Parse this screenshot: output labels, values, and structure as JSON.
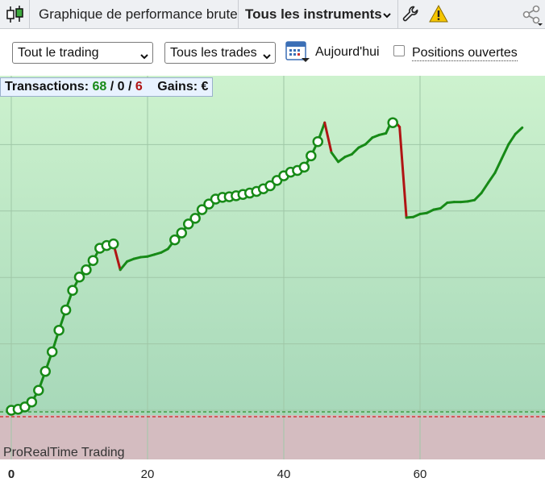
{
  "toolbar": {
    "candles_icon": "candlestick-chart-icon",
    "title": "Graphique de performance brute",
    "instruments": "Tous les instruments",
    "wrench_icon": "wrench-icon",
    "warning_icon": "warning-icon",
    "share_icon": "share-icon"
  },
  "filters": {
    "trading_select": "Tout le trading",
    "trades_select": "Tous les trades",
    "calendar_icon": "calendar-icon",
    "date_label": "Aujourd'hui",
    "open_positions_label": "Positions ouvertes",
    "open_positions_checked": false
  },
  "summary": {
    "transactions_label": "Transactions:",
    "wins": "68",
    "sep1": "/",
    "neutral": "0",
    "sep2": "/",
    "losses": "6",
    "gains_label": "Gains: €"
  },
  "watermark": "ProRealTime Trading",
  "colors": {
    "win": "#178a17",
    "loss": "#b01414",
    "profit_zone_top": "#c8f0c8",
    "profit_zone_bottom": "#a8d8b8",
    "loss_zone": "#d4bcc0"
  },
  "chart_data": {
    "type": "line",
    "title": "",
    "xlabel": "",
    "ylabel": "",
    "x_ticks": [
      "0",
      "20",
      "40",
      "60"
    ],
    "xlim": [
      0,
      78
    ],
    "ylim": [
      -5.6,
      100
    ],
    "y_gridlines": [
      0,
      20,
      40,
      60,
      80
    ],
    "trade_markers": {
      "x": [
        0,
        1,
        2,
        3,
        4,
        5,
        6,
        7,
        8,
        9,
        10,
        11,
        12,
        13,
        14,
        15,
        24,
        25,
        26,
        27,
        28,
        29,
        30,
        31,
        32,
        33,
        34,
        35,
        36,
        37,
        38,
        39,
        40,
        41,
        42,
        43,
        44,
        45,
        56
      ],
      "y": [
        0,
        0.3,
        1,
        2.5,
        6,
        11.7,
        17.6,
        24.1,
        30.2,
        36.1,
        40.1,
        42.3,
        45.1,
        48.8,
        49.6,
        50.1,
        51.3,
        53.4,
        56.1,
        57.8,
        60.4,
        62.1,
        63.6,
        64.1,
        64.3,
        64.6,
        65,
        65.4,
        65.9,
        66.7,
        67.6,
        69.2,
        70.6,
        71.7,
        72.2,
        73.2,
        76.6,
        80.9,
        86.6,
        87.8
      ]
    },
    "path": {
      "x": [
        0,
        1,
        2,
        3,
        4,
        5,
        6,
        7,
        8,
        9,
        10,
        11,
        12,
        13,
        14,
        15,
        16,
        17,
        18,
        19,
        20,
        21,
        22,
        23,
        24,
        25,
        26,
        27,
        28,
        29,
        30,
        31,
        32,
        33,
        34,
        35,
        36,
        37,
        38,
        39,
        40,
        41,
        42,
        43,
        44,
        45,
        46,
        47,
        48,
        49,
        50,
        51,
        52,
        53,
        54,
        55,
        56,
        57,
        58,
        59,
        60,
        61,
        62,
        63,
        64,
        65,
        66,
        67,
        68,
        69,
        70,
        71,
        72,
        73,
        74,
        75
      ],
      "y": [
        0,
        0.3,
        1,
        2.5,
        6,
        11.7,
        17.6,
        24.1,
        30.2,
        36.1,
        40.1,
        42.3,
        45.1,
        48.8,
        49.6,
        50.1,
        42.3,
        44.8,
        45.6,
        46.1,
        46.3,
        46.9,
        47.5,
        48.6,
        51.3,
        53.4,
        56.1,
        57.8,
        60.4,
        62.1,
        63.6,
        64.1,
        64.3,
        64.6,
        65,
        65.4,
        65.9,
        66.7,
        67.6,
        69.2,
        70.6,
        71.7,
        72.2,
        73.2,
        76.6,
        80.9,
        86.6,
        77.6,
        74.8,
        76.3,
        77.1,
        79.1,
        80.1,
        82.1,
        82.9,
        83.4,
        87.8,
        85.3,
        58,
        58.2,
        59.1,
        59.4,
        60.4,
        60.8,
        62.5,
        62.7,
        62.7,
        62.9,
        63.3,
        65.4,
        68.5,
        71.5,
        75.8,
        80.1,
        83.2,
        85.1
      ],
      "loss_segments": [
        [
          15,
          16
        ],
        [
          46,
          47
        ],
        [
          56,
          57
        ],
        [
          57,
          58
        ]
      ]
    },
    "baseline": 0
  }
}
